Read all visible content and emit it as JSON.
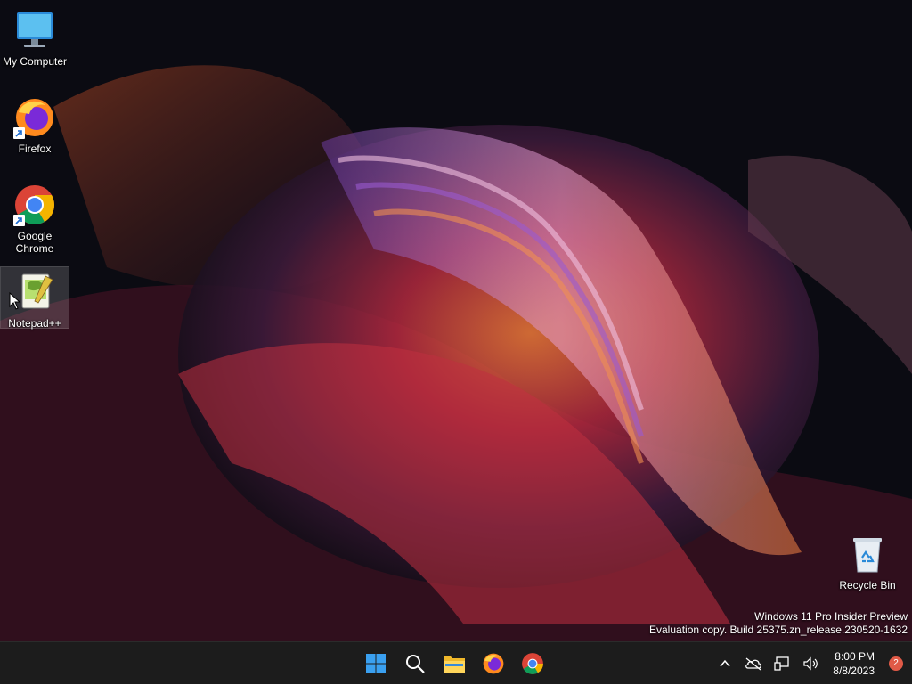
{
  "desktop": {
    "icons": [
      {
        "label": "My Computer",
        "name": "my-computer"
      },
      {
        "label": "Firefox",
        "name": "firefox"
      },
      {
        "label": "Google Chrome",
        "name": "google-chrome"
      },
      {
        "label": "Notepad++",
        "name": "notepad-plus-plus"
      },
      {
        "label": "Recycle Bin",
        "name": "recycle-bin"
      }
    ]
  },
  "watermark": {
    "line1": "Windows 11 Pro Insider Preview",
    "line2": "Evaluation copy. Build 25375.zn_release.230520-1632"
  },
  "taskbar": {
    "pinned": [
      "start-icon",
      "search-icon",
      "file-explorer-icon",
      "firefox-icon",
      "chrome-icon"
    ],
    "tray": {
      "icons": [
        "chevron-up-icon",
        "onedrive-offline-icon",
        "network-icon",
        "volume-icon"
      ],
      "time": "8:00 PM",
      "date": "8/8/2023",
      "notification_count": "2"
    }
  },
  "colors": {
    "taskbar_bg": "#1c1c1c",
    "badge": "#e05a47",
    "start_blue": "#3aa0f0"
  }
}
